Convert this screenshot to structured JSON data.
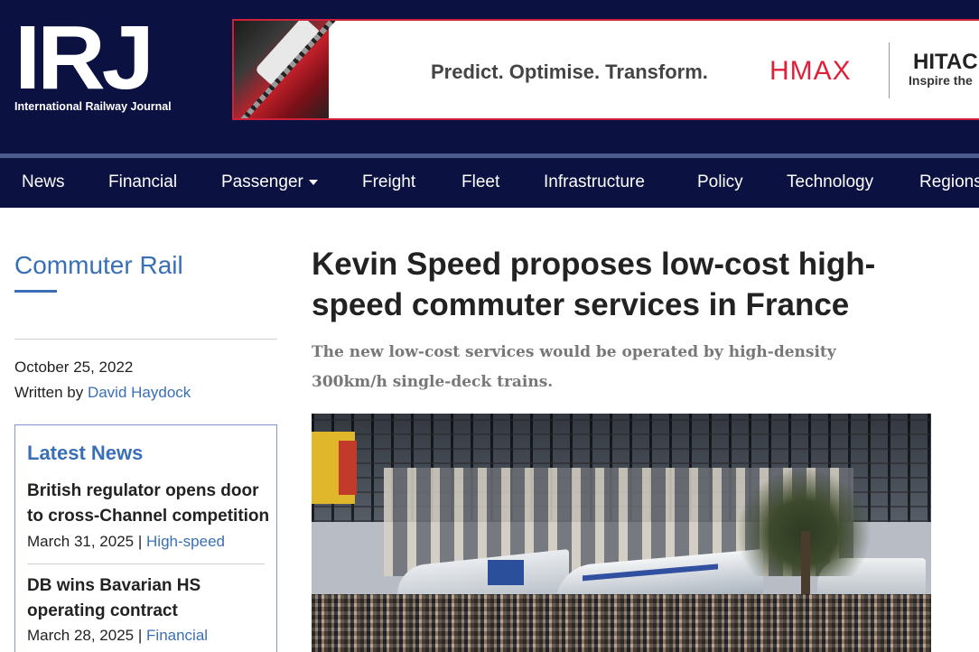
{
  "logo": {
    "text": "IRJ",
    "subtitle": "International Railway Journal"
  },
  "ad": {
    "tagline": "Predict. Optimise. Transform.",
    "brand_hmax": "HMAX",
    "brand_hitachi": "HITAC",
    "brand_inspire": "Inspire the",
    "colors": {
      "border": "#d0203a",
      "hmax": "#e0203a"
    }
  },
  "nav": {
    "items": [
      {
        "label": "News"
      },
      {
        "label": "Financial"
      },
      {
        "label": "Passenger"
      },
      {
        "label": "Freight"
      },
      {
        "label": "Fleet"
      },
      {
        "label": "Infrastructure"
      },
      {
        "label": "Policy"
      },
      {
        "label": "Technology"
      },
      {
        "label": "Regions"
      }
    ],
    "dropdown_icon": "caret-down-icon"
  },
  "sidebar": {
    "section_title": "Commuter Rail",
    "date": "October 25, 2022",
    "written_by_label": "Written by",
    "author": "David Haydock",
    "latest_news": {
      "title": "Latest News",
      "items": [
        {
          "headline": "British regulator opens door to cross-Channel competition",
          "date": "March 31, 2025",
          "separator": "|",
          "category": "High-speed"
        },
        {
          "headline": "DB wins Bavarian HS operating contract",
          "date": "March 28, 2025",
          "separator": "|",
          "category": "Financial"
        }
      ]
    }
  },
  "article": {
    "headline": "Kevin Speed proposes low-cost high-speed commuter services in France",
    "standfirst": "The new low-cost services would be operated by high-density 300km/h single-deck trains."
  },
  "colors": {
    "header_bg": "#0b1140",
    "accent_blue": "#3a6fb5",
    "nav_separator": "#4a5a8c"
  }
}
